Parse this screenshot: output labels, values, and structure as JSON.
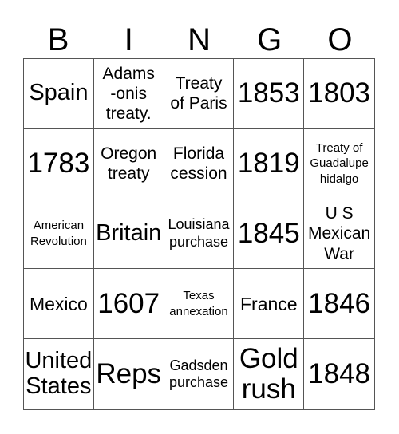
{
  "header": {
    "letters": [
      "B",
      "I",
      "N",
      "G",
      "O"
    ]
  },
  "cells": [
    {
      "text": "Spain",
      "size": "s-l"
    },
    {
      "text": "Adams\n-onis\ntreaty.",
      "size": "s-m2"
    },
    {
      "text": "Treaty\nof Paris",
      "size": "s-m2"
    },
    {
      "text": "1853",
      "size": "s-xl"
    },
    {
      "text": "1803",
      "size": "s-xl"
    },
    {
      "text": "1783",
      "size": "s-xl"
    },
    {
      "text": "Oregon\ntreaty",
      "size": "s-m2"
    },
    {
      "text": "Florida\ncession",
      "size": "s-m2"
    },
    {
      "text": "1819",
      "size": "s-xl"
    },
    {
      "text": "Treaty of\nGuadalupe\nhidalgo",
      "size": "s-xs"
    },
    {
      "text": "American\nRevolution",
      "size": "s-xs"
    },
    {
      "text": "Britain",
      "size": "s-l"
    },
    {
      "text": "Louisiana\npurchase",
      "size": "s-s"
    },
    {
      "text": "1845",
      "size": "s-xl"
    },
    {
      "text": "U S\nMexican\nWar",
      "size": "s-m2"
    },
    {
      "text": "Mexico",
      "size": "s-m"
    },
    {
      "text": "1607",
      "size": "s-xl"
    },
    {
      "text": "Texas\nannexation",
      "size": "s-xs"
    },
    {
      "text": "France",
      "size": "s-m"
    },
    {
      "text": "1846",
      "size": "s-xl"
    },
    {
      "text": "United\nStates",
      "size": "s-l"
    },
    {
      "text": "Reps",
      "size": "s-xl"
    },
    {
      "text": "Gadsden\npurchase",
      "size": "s-s"
    },
    {
      "text": "Gold\nrush",
      "size": "s-xl"
    },
    {
      "text": "1848",
      "size": "s-xl"
    }
  ]
}
